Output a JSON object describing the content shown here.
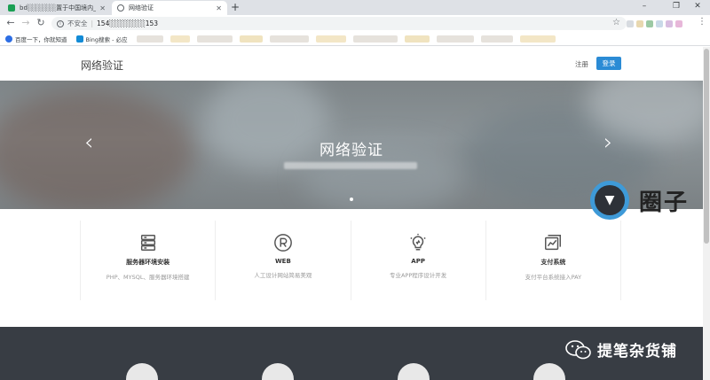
{
  "browser": {
    "tabs": [
      {
        "title": "bd░░░░░░置于中国境内_IP安查",
        "active": false
      },
      {
        "title": "网络验证",
        "active": true
      }
    ],
    "new_tab": "+",
    "window_controls": {
      "minimize": "–",
      "maximize": "❐",
      "close": "✕"
    },
    "nav": {
      "back": "←",
      "forward": "→",
      "reload": "↻"
    },
    "address": {
      "security_label": "不安全",
      "url": "154░░░░░░░153"
    },
    "bookmarks": [
      {
        "label": "百度一下，你就知道",
        "icon": "paw-icon",
        "color": "#2d6ee4"
      },
      {
        "label": "Bing搜索 - 必应",
        "icon": "bing-icon",
        "color": "#138bd6"
      }
    ]
  },
  "header": {
    "brand": "网络验证",
    "register": "注册",
    "login": "登录",
    "accent": "#2b8bd5"
  },
  "hero": {
    "title": "网络验证",
    "prev": "‹",
    "next": "›"
  },
  "features": [
    {
      "icon": "server-icon",
      "title": "服务器环境安装",
      "desc": "PHP、MYSQL、服务器环境搭建"
    },
    {
      "icon": "registered-icon",
      "title": "WEB",
      "desc": "人工设计网站简易美观"
    },
    {
      "icon": "lightbulb-icon",
      "title": "APP",
      "desc": "专业APP程序设计开发"
    },
    {
      "icon": "chart-card-icon",
      "title": "支付系统",
      "desc": "支付平台系统接入PAY"
    }
  ],
  "watermarks": {
    "circle_text": "圈子",
    "wechat_text": "提笔杂货铺"
  }
}
